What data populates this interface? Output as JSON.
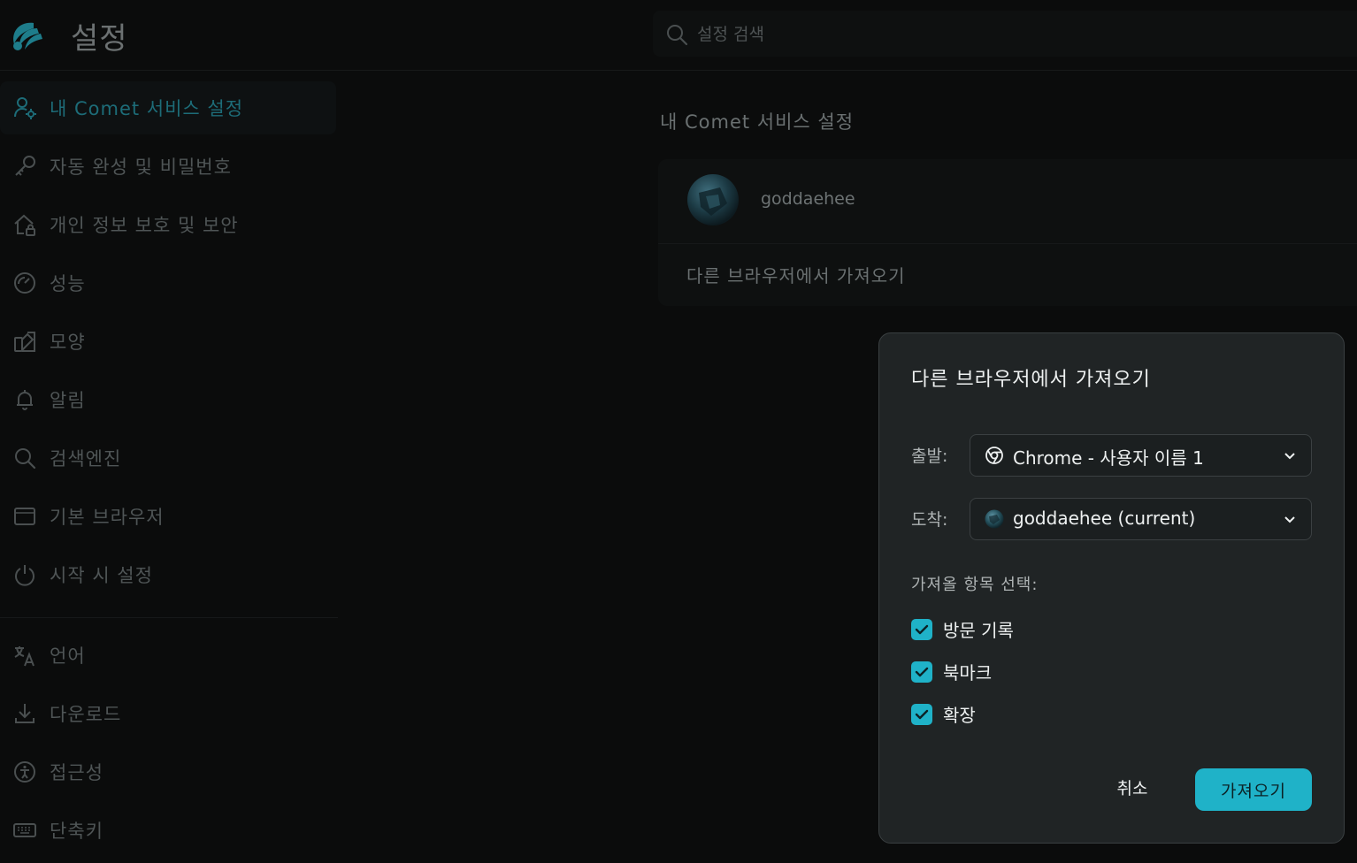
{
  "header": {
    "title": "설정",
    "search_placeholder": "설정 검색"
  },
  "sidebar": {
    "items": [
      {
        "label": "내 Comet 서비스 설정",
        "icon": "user-gear-icon",
        "active": true
      },
      {
        "label": "자동 완성 및 비밀번호",
        "icon": "key-icon"
      },
      {
        "label": "개인 정보 보호 및 보안",
        "icon": "house-lock-icon"
      },
      {
        "label": "성능",
        "icon": "gauge-icon"
      },
      {
        "label": "모양",
        "icon": "palette-icon"
      },
      {
        "label": "알림",
        "icon": "bell-icon"
      },
      {
        "label": "검색엔진",
        "icon": "search-icon"
      },
      {
        "label": "기본 브라우저",
        "icon": "browser-window-icon"
      },
      {
        "label": "시작 시 설정",
        "icon": "power-icon"
      },
      {
        "label": "언어",
        "icon": "translate-icon"
      },
      {
        "label": "다운로드",
        "icon": "download-icon"
      },
      {
        "label": "접근성",
        "icon": "accessibility-icon"
      },
      {
        "label": "단축키",
        "icon": "keyboard-icon"
      }
    ]
  },
  "main": {
    "section_title": "내 Comet 서비스 설정",
    "profile": {
      "username": "goddaehee"
    },
    "import_link": "다른 브라우저에서 가져오기"
  },
  "dialog": {
    "title": "다른 브라우저에서 가져오기",
    "from_label": "출발:",
    "from_value": "Chrome - 사용자 이름 1",
    "to_label": "도착:",
    "to_value": "goddaehee (current)",
    "items_label": "가져올 항목 선택:",
    "items": [
      {
        "label": "방문 기록",
        "checked": true
      },
      {
        "label": "북마크",
        "checked": true
      },
      {
        "label": "확장",
        "checked": true
      }
    ],
    "cancel_label": "취소",
    "import_label": "가져오기"
  },
  "colors": {
    "accent": "#1fb2c8",
    "background": "#0b0c0c",
    "dialog_bg": "#202425",
    "active_nav_text": "#1d6c78"
  }
}
